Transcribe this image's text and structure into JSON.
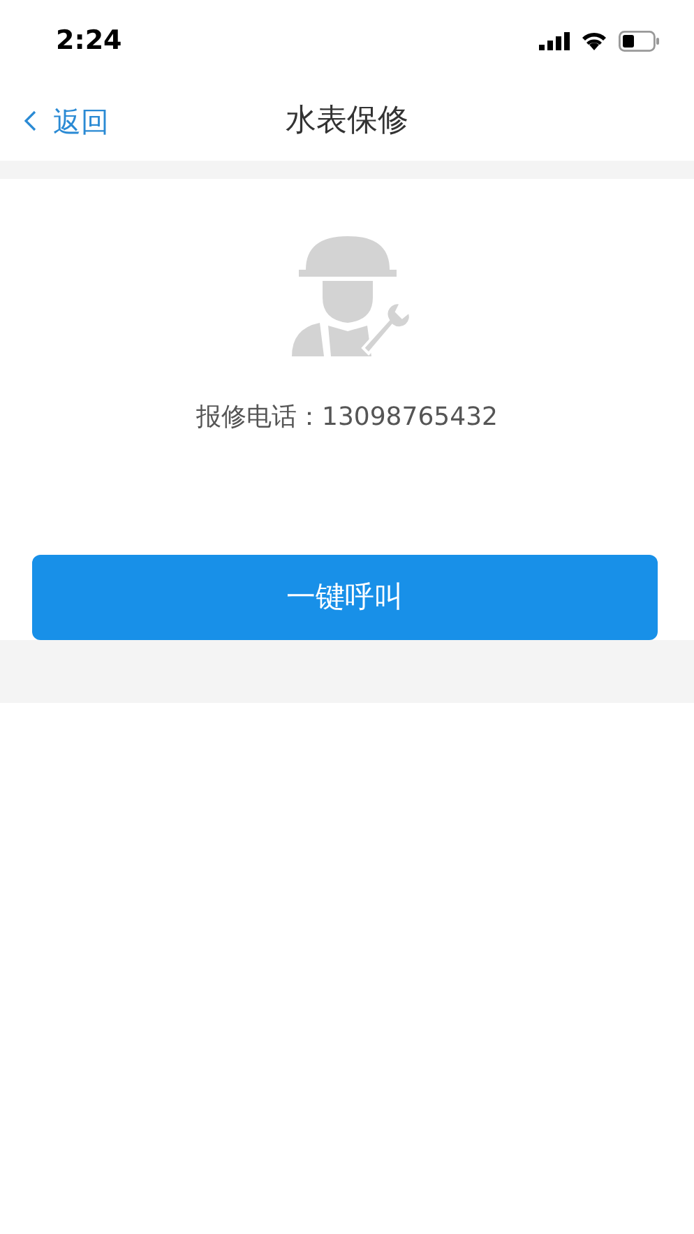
{
  "status_bar": {
    "time": "2:24"
  },
  "nav": {
    "back": "返回",
    "title": "水表保修"
  },
  "repair": {
    "phone_text": "报修电话：13098765432"
  },
  "call_button": "一键呼叫"
}
